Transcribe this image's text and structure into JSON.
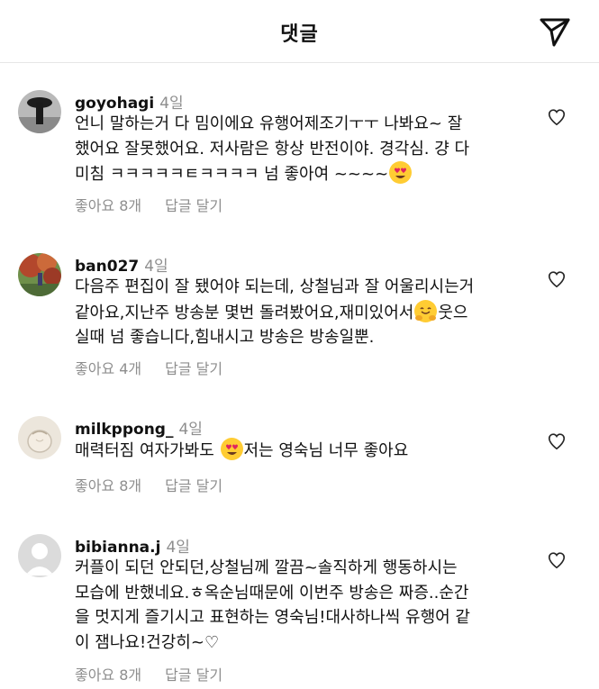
{
  "header": {
    "title": "댓글"
  },
  "comments": [
    {
      "username": "goyohagi",
      "time": "4일",
      "text": "언니 말하는거 다 밈이에요 유행어제조기ㅜㅜ 나봐요~ 잘\n했어요 잘못했어요. 저사람은 항상 반전이야. 경각심.  걍 다\n미침 ㅋㅋㅋㅋㅋㅌㅋㅋㅋㅋ 넘 좋아여 ~~~~",
      "likes": "좋아요 8개",
      "reply": "답글 달기"
    },
    {
      "username": "ban027",
      "time": "4일",
      "text_a": "다음주 편집이 잘 됐어야 되는데, 상철님과 잘 어울리시는거\n같아요,지난주 방송분 몇번 돌려봤어요,재미있어서",
      "text_b": "웃으\n실때 넘 좋습니다,힘내시고 방송은 방송일뿐.",
      "likes": "좋아요 4개",
      "reply": "답글 달기"
    },
    {
      "username": "milkppong_",
      "time": "4일",
      "text_a": "매력터짐 여자가봐도",
      "text_b": "저는 영숙님 너무 좋아요",
      "likes": "좋아요 8개",
      "reply": "답글 달기"
    },
    {
      "username": "bibianna.j",
      "time": "4일",
      "text": "커플이 되던 안되던,상철님께 깔끔~솔직하게 행동하시는\n모습에 반했네요.ㅎ옥순님때문에 이번주 방송은 짜증..순간\n을 멋지게 즐기시고 표현하는 영숙님!대사하나씩 유행어 같\n이 잼나요!건강히~♡",
      "likes": "좋아요 8개",
      "reply": "답글 달기"
    }
  ]
}
